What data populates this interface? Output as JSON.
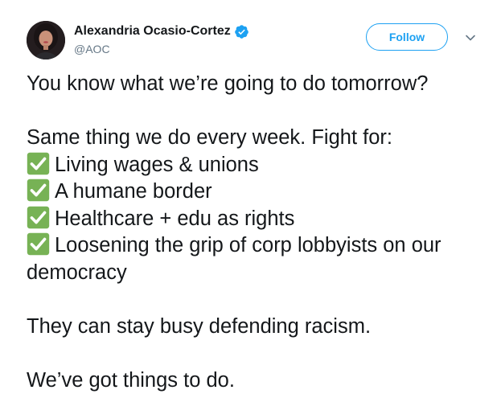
{
  "author": {
    "display_name": "Alexandria Ocasio-Cortez",
    "handle": "@AOC",
    "verified": true,
    "avatar_icon": "profile-photo"
  },
  "actions": {
    "follow_label": "Follow",
    "more_icon": "chevron-down-icon"
  },
  "colors": {
    "accent": "#1da1f2",
    "text": "#14171a",
    "muted": "#657786",
    "check_green": "#77b255"
  },
  "tweet": {
    "line_1": "You know what we’re going to do tomorrow?",
    "intro": "Same thing we do every week. Fight for:",
    "items": [
      "Living wages & unions",
      "A humane border",
      "Healthcare + edu as rights",
      "Loosening the grip of corp lobbyists on our democracy"
    ],
    "line_3": "They can stay busy defending racism.",
    "line_4": "We’ve got things to do."
  }
}
